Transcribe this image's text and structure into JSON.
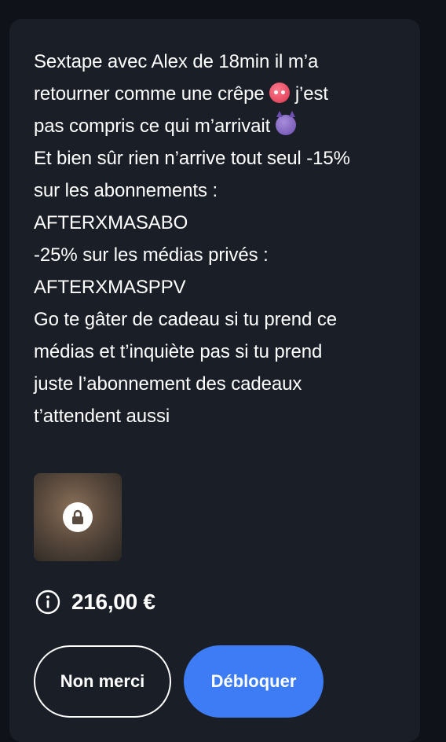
{
  "message": {
    "lines": [
      "Sextape avec Alex de 18min il m’a",
      "retourner comme une crêpe",
      "j’est",
      "pas compris ce qui m’arrivait",
      "Et bien sûr rien n’arrive tout seul -15%",
      "sur les abonnements :",
      "AFTERXMASABO",
      "-25% sur les médias privés :",
      "AFTERXMASPPV",
      "Go te gâter de cadeau si tu prend ce",
      "médias et t’inquiète pas si tu prend",
      "juste l’abonnement des cadeaux",
      "t’attendent aussi"
    ],
    "emojis": [
      "hot-face-emoji",
      "smiling-devil-emoji"
    ]
  },
  "media": {
    "locked": true,
    "icon": "lock-icon"
  },
  "price": {
    "amount": "216,00 €",
    "icon": "info-icon"
  },
  "actions": {
    "decline_label": "Non merci",
    "unlock_label": "Débloquer"
  },
  "colors": {
    "background": "#0f1219",
    "card": "#1a1e27",
    "accent": "#3d7cf5",
    "text": "#ffffff"
  }
}
